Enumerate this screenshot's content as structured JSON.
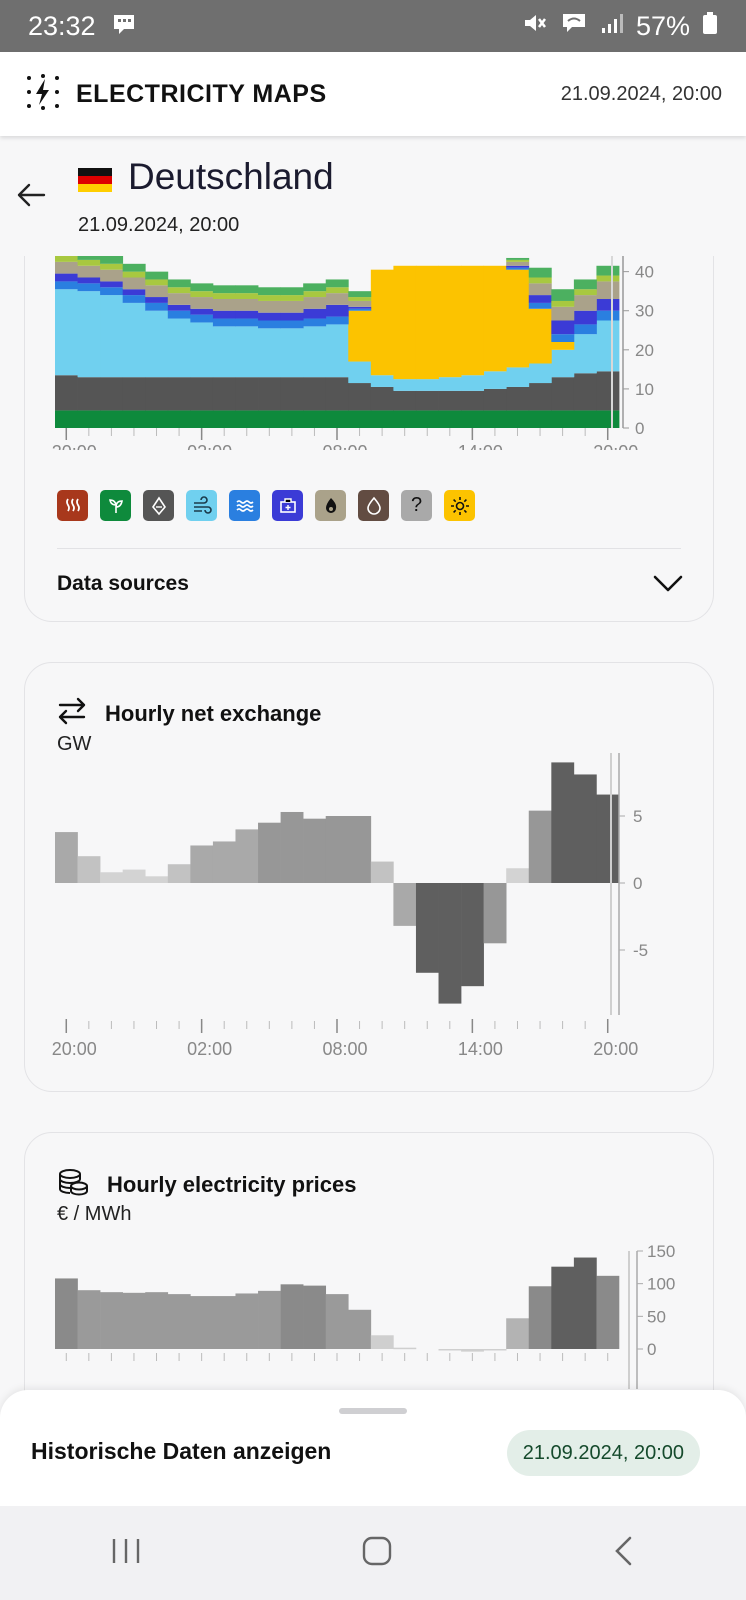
{
  "status_bar": {
    "time": "23:32",
    "battery": "57%"
  },
  "header": {
    "brand": "ELECTRICITY MAPS",
    "datetime": "21.09.2024, 20:00"
  },
  "zone": {
    "name": "Deutschland",
    "datetime": "21.09.2024, 20:00"
  },
  "production_chart": {
    "x_ticks": [
      "20:00",
      "02:00",
      "08:00",
      "14:00",
      "20:00"
    ],
    "y_ticks": [
      "0",
      "10",
      "20",
      "30",
      "40"
    ]
  },
  "legend": [
    {
      "icon": "biomass-heat-icon",
      "color": "#a8381c"
    },
    {
      "icon": "biomass-leaf-icon",
      "color": "#0e8a3c"
    },
    {
      "icon": "coal-icon",
      "color": "#555555"
    },
    {
      "icon": "wind-icon",
      "color": "#70d0ef"
    },
    {
      "icon": "hydro-icon",
      "color": "#2a7fe0"
    },
    {
      "icon": "storage-icon",
      "color": "#3b3bd6"
    },
    {
      "icon": "gas-icon",
      "color": "#aaa28a"
    },
    {
      "icon": "oil-icon",
      "color": "#624c42"
    },
    {
      "icon": "unknown-icon",
      "color": "#a9a9a9",
      "glyph": "?"
    },
    {
      "icon": "solar-icon",
      "color": "#fcc300"
    }
  ],
  "data_sources_label": "Data sources",
  "exchange": {
    "title": "Hourly net exchange",
    "unit": "GW",
    "y_ticks": [
      "5",
      "0",
      "-5"
    ],
    "x_ticks": [
      "20:00",
      "02:00",
      "08:00",
      "14:00",
      "20:00"
    ]
  },
  "prices": {
    "title": "Hourly electricity prices",
    "unit": "€ / MWh",
    "y_ticks": [
      "150",
      "100",
      "50",
      "0"
    ]
  },
  "bottom_sheet": {
    "label": "Historische Daten anzeigen",
    "date": "21.09.2024, 20:00"
  },
  "chart_data": [
    {
      "type": "area",
      "x": [
        "20:00",
        "21:00",
        "22:00",
        "23:00",
        "00:00",
        "01:00",
        "02:00",
        "03:00",
        "04:00",
        "05:00",
        "06:00",
        "07:00",
        "08:00",
        "09:00",
        "10:00",
        "11:00",
        "12:00",
        "13:00",
        "14:00",
        "15:00",
        "16:00",
        "17:00",
        "18:00",
        "19:00",
        "20:00"
      ],
      "ylim": [
        0,
        44
      ],
      "series": [
        {
          "color": "#0e8a3c",
          "values": [
            4.5,
            4.5,
            4.5,
            4.5,
            4.5,
            4.5,
            4.5,
            4.5,
            4.5,
            4.5,
            4.5,
            4.5,
            4.5,
            4.5,
            4.5,
            4.5,
            4.5,
            4.5,
            4.5,
            4.5,
            4.5,
            4.5,
            4.5,
            4.5,
            4.5
          ]
        },
        {
          "color": "#555555",
          "values": [
            9,
            8.5,
            8.5,
            8.5,
            8.5,
            8.5,
            8.5,
            8.5,
            8.5,
            8.5,
            8.5,
            8.5,
            8.5,
            7,
            6,
            5,
            5,
            5,
            5,
            5.5,
            6,
            7,
            8.5,
            9.5,
            10
          ]
        },
        {
          "color": "#70d0ef",
          "values": [
            22,
            22,
            21,
            19,
            17,
            15,
            14,
            13,
            13,
            12.5,
            12.5,
            13,
            13.5,
            5.5,
            3,
            3,
            3,
            3.5,
            4,
            4.5,
            5,
            5,
            7,
            10,
            13
          ]
        },
        {
          "color": "#fcc300",
          "values": [
            0,
            0,
            0,
            0,
            0,
            0,
            0,
            0,
            0,
            0,
            0,
            0,
            0,
            13,
            27,
            29,
            29,
            28.5,
            28,
            27,
            25,
            14,
            2,
            0,
            0
          ]
        },
        {
          "color": "#2a7fe0",
          "values": [
            2,
            2,
            2,
            2,
            2,
            2,
            2,
            2,
            2,
            2,
            2,
            2,
            2,
            0.5,
            0,
            0,
            0,
            0,
            0,
            0,
            0.5,
            1.5,
            2,
            2.5,
            2.5
          ]
        },
        {
          "color": "#3b3bd6",
          "values": [
            2,
            1.5,
            1.5,
            1.5,
            1.5,
            1.5,
            1.5,
            2,
            2,
            2,
            2,
            2.5,
            3,
            0.5,
            0,
            0,
            0,
            0,
            0,
            0,
            0.5,
            2,
            3.5,
            3.5,
            3
          ]
        },
        {
          "color": "#aaa28a",
          "values": [
            3,
            3,
            3,
            3,
            3,
            3,
            3,
            3,
            3,
            3,
            3,
            3,
            3,
            1.5,
            0,
            0,
            0,
            0,
            0,
            0,
            1,
            3,
            3.5,
            4,
            4.5
          ]
        },
        {
          "color": "#a8c840",
          "values": [
            1.5,
            1.5,
            1.5,
            1.5,
            1.5,
            1.5,
            1.5,
            1.5,
            1.5,
            1.5,
            1.5,
            1.5,
            1.5,
            1,
            0,
            0,
            0,
            0,
            0,
            0,
            0.5,
            1.5,
            1.5,
            1.5,
            1.5
          ]
        },
        {
          "color": "#4cb060",
          "values": [
            2,
            2,
            2,
            2,
            2,
            2,
            2,
            2,
            2,
            2,
            2,
            2,
            2,
            1.5,
            0,
            0,
            0,
            0,
            0,
            0,
            0.5,
            2.5,
            3,
            2.5,
            2.5
          ]
        }
      ]
    },
    {
      "type": "bar",
      "title": "Hourly net exchange",
      "ylabel": "GW",
      "categories": [
        "20:00",
        "21:00",
        "22:00",
        "23:00",
        "00:00",
        "01:00",
        "02:00",
        "03:00",
        "04:00",
        "05:00",
        "06:00",
        "07:00",
        "08:00",
        "09:00",
        "10:00",
        "11:00",
        "12:00",
        "13:00",
        "14:00",
        "15:00",
        "16:00",
        "17:00",
        "18:00",
        "19:00",
        "20:00"
      ],
      "values": [
        3.8,
        2,
        0.8,
        1,
        0.5,
        1.4,
        2.8,
        3.1,
        4,
        4.5,
        5.3,
        4.8,
        5,
        5,
        1.6,
        -3.2,
        -6.7,
        -9,
        -7.7,
        -4.5,
        1.1,
        5.4,
        9,
        8.1,
        6.6
      ],
      "ylim": [
        -10,
        10
      ]
    },
    {
      "type": "bar",
      "title": "Hourly electricity prices",
      "ylabel": "€ / MWh",
      "categories": [
        "20:00",
        "21:00",
        "22:00",
        "23:00",
        "00:00",
        "01:00",
        "02:00",
        "03:00",
        "04:00",
        "05:00",
        "06:00",
        "07:00",
        "08:00",
        "09:00",
        "10:00",
        "11:00",
        "12:00",
        "13:00",
        "14:00",
        "15:00",
        "16:00",
        "17:00",
        "18:00",
        "19:00",
        "20:00"
      ],
      "values": [
        108,
        90,
        87,
        86,
        87,
        84,
        81,
        81,
        85,
        89,
        99,
        97,
        84,
        60,
        21,
        2,
        0,
        -2,
        -4,
        -1,
        47,
        96,
        126,
        140,
        112
      ],
      "ylim": [
        0,
        150
      ]
    }
  ]
}
